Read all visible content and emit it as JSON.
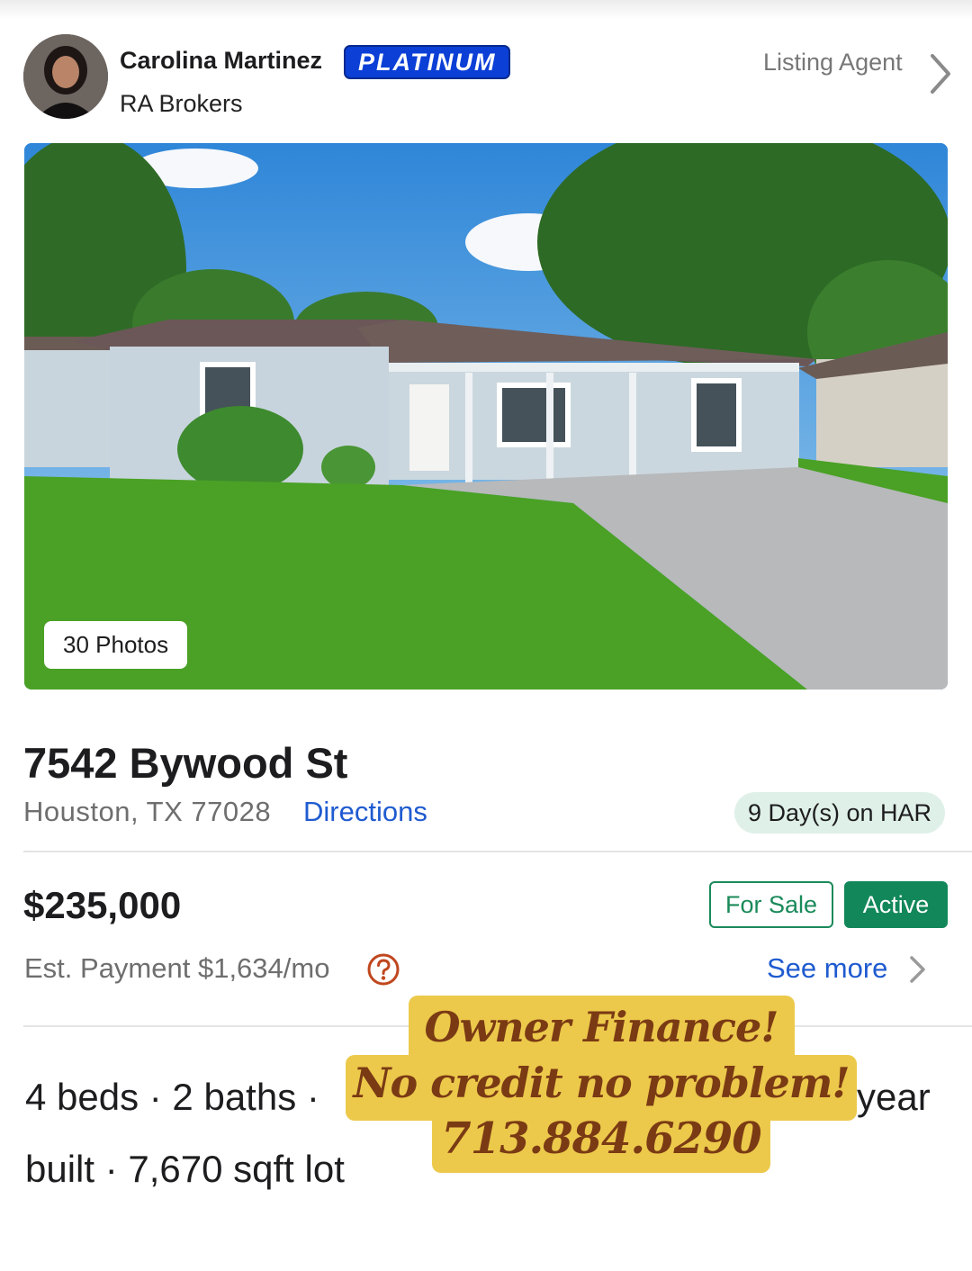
{
  "agent": {
    "name": "Carolina Martinez",
    "badge": "PLATINUM",
    "broker": "RA Brokers",
    "role_link": "Listing Agent"
  },
  "photo": {
    "count_label": "30 Photos"
  },
  "property": {
    "address": "7542 Bywood St",
    "city_state_zip": "Houston, TX 77028",
    "directions_label": "Directions",
    "days_on_market": "9 Day(s) on HAR"
  },
  "pricing": {
    "price": "$235,000",
    "status_type": "For Sale",
    "status": "Active",
    "est_payment": "Est. Payment $1,634/mo",
    "see_more_label": "See more"
  },
  "details": {
    "line1": "4 beds · 2 baths ·",
    "line1_tail": "year",
    "line2": "built · 7,670 sqft lot"
  },
  "promo": {
    "line1": "Owner Finance!",
    "line2": "No credit no problem!",
    "line3": "713.884.6290"
  },
  "colors": {
    "brand_blue": "#0b3fd6",
    "link_blue": "#1f5bd0",
    "active_green": "#12875a",
    "promo_bg": "#ecc94b",
    "promo_text": "#7a3a14"
  }
}
